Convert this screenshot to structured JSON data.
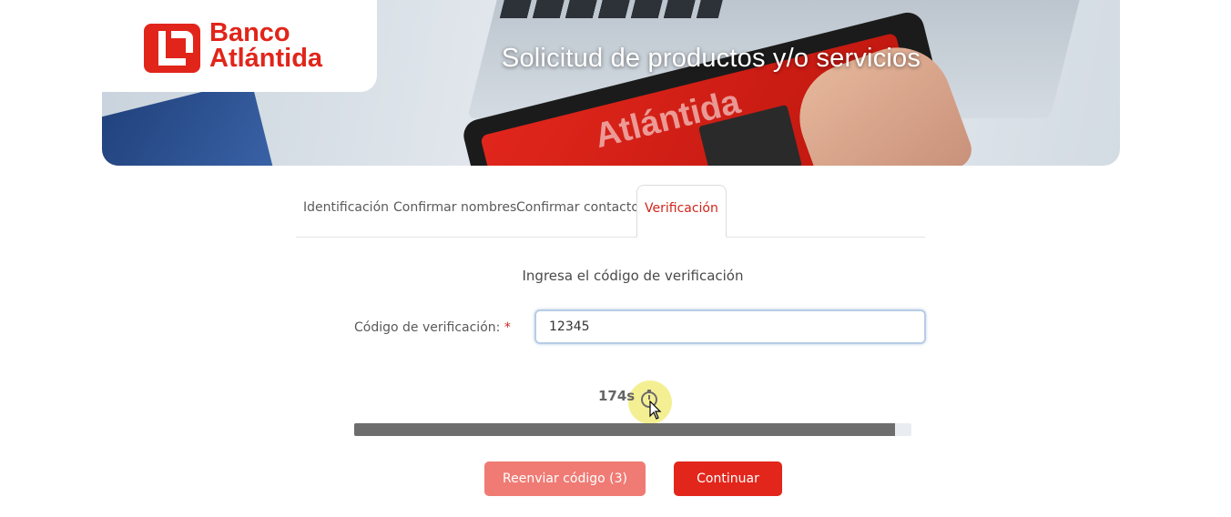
{
  "banner": {
    "title": "Solicitud de productos y/o servicios",
    "tablet_word": "Atlántida"
  },
  "logo": {
    "line1": "Banco",
    "line2": "Atlántida",
    "brand_color": "#e1251b"
  },
  "tabs": [
    {
      "label": "Identificación",
      "active": false
    },
    {
      "label": "Confirmar nombres",
      "active": false
    },
    {
      "label": "Confirmar contactos",
      "active": false
    },
    {
      "label": "Verificación",
      "active": true
    }
  ],
  "form": {
    "heading": "Ingresa el código de verificación",
    "code_label": "Código de verificación:",
    "required_mark": "*",
    "code_value": "12345"
  },
  "timer": {
    "text": "174s",
    "icon": "stopwatch-icon",
    "progress_percent": 97
  },
  "buttons": {
    "resend": "Reenviar código (3)",
    "continue": "Continuar"
  },
  "colors": {
    "accent": "#e3261c",
    "resend_bg": "#ef7b74",
    "active_tab": "#d0251b"
  }
}
